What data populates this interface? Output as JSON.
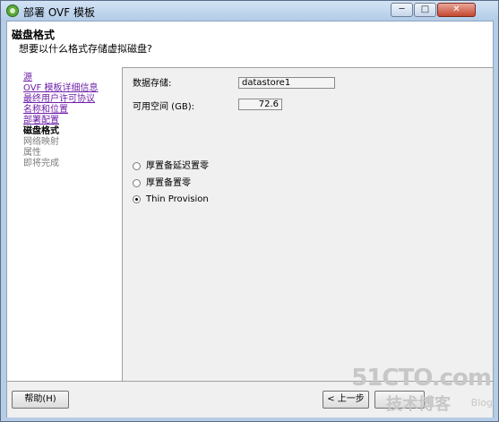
{
  "window": {
    "title": "部署 OVF 模板",
    "minimize_label": "─",
    "maximize_label": "□",
    "close_label": "✕"
  },
  "header": {
    "title": "磁盘格式",
    "subtitle": "想要以什么格式存储虚拟磁盘?"
  },
  "steps": [
    {
      "label": "源",
      "state": "link"
    },
    {
      "label": "OVF 模板详细信息",
      "state": "link"
    },
    {
      "label": "最终用户许可协议",
      "state": "link"
    },
    {
      "label": "名称和位置",
      "state": "link"
    },
    {
      "label": "部署配置",
      "state": "link"
    },
    {
      "label": "磁盘格式",
      "state": "current"
    },
    {
      "label": "网络映射",
      "state": "future"
    },
    {
      "label": "属性",
      "state": "future"
    },
    {
      "label": "即将完成",
      "state": "future"
    }
  ],
  "content": {
    "datastore_label": "数据存储:",
    "datastore_value": "datastore1",
    "free_space_label": "可用空间 (GB):",
    "free_space_value": "72.6",
    "options": [
      {
        "label": "厚置备延迟置零",
        "selected": false
      },
      {
        "label": "厚置备置零",
        "selected": false
      },
      {
        "label": "Thin Provision",
        "selected": true
      }
    ]
  },
  "footer": {
    "help_label": "帮助(H)",
    "back_label": "< 上一步"
  },
  "watermark": {
    "site": "51CTO.com",
    "sub": "技术博客",
    "blog": "Blog"
  },
  "colors": {
    "link": "#6e1fa8",
    "future": "#7d7d7d",
    "titlebar": "#b7cde6"
  }
}
